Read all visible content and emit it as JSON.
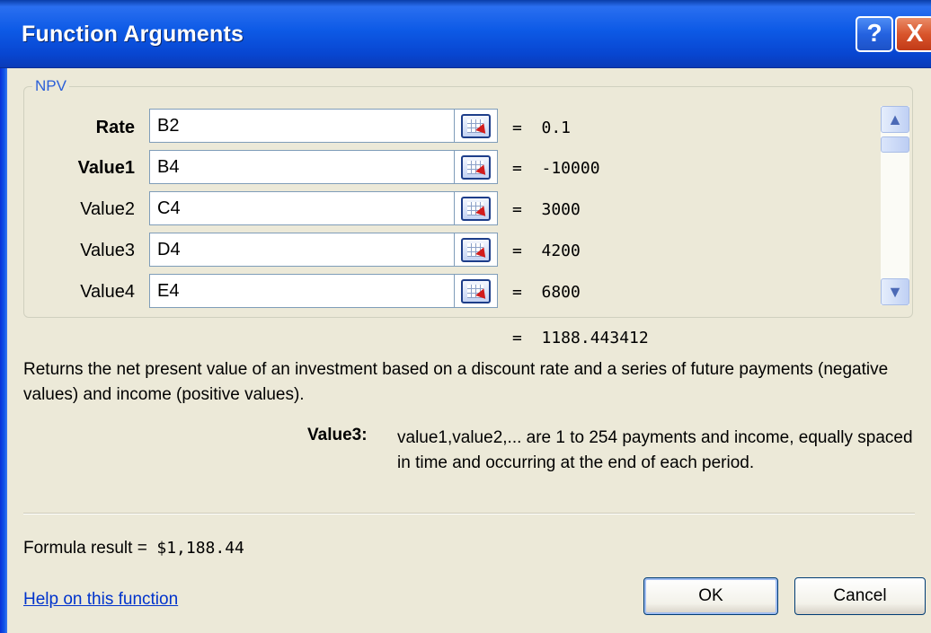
{
  "window": {
    "title": "Function Arguments",
    "help_symbol": "?",
    "close_symbol": "X"
  },
  "function": {
    "name": "NPV",
    "arguments": [
      {
        "label": "Rate",
        "bold": true,
        "input": "B2",
        "value": "=  0.1"
      },
      {
        "label": "Value1",
        "bold": true,
        "input": "B4",
        "value": "=  -10000"
      },
      {
        "label": "Value2",
        "bold": false,
        "input": "C4",
        "value": "=  3000"
      },
      {
        "label": "Value3",
        "bold": false,
        "input": "D4",
        "value": "=  4200"
      },
      {
        "label": "Value4",
        "bold": false,
        "input": "E4",
        "value": "=  6800"
      }
    ],
    "result": "=  1188.443412",
    "description": "Returns the net present value of an investment based on a discount rate and a series of future payments (negative values) and income (positive values).",
    "selected_argument": "Value3:",
    "argument_description": "value1,value2,... are 1 to 254 payments and income, equally spaced in time and occurring at the end of each period."
  },
  "footer": {
    "formula_result_label": "Formula result =",
    "formula_result_value": "$1,188.44",
    "help_link": "Help on this function",
    "ok_label": "OK",
    "cancel_label": "Cancel"
  },
  "colors": {
    "titlebar": "#0d5ae6",
    "dialog_bg": "#ece9d8",
    "group_title": "#2b5fd8",
    "link": "#0033cc"
  },
  "icons": {
    "help": "help-icon",
    "close": "close-icon",
    "ref": "range-select-icon",
    "scroll_up": "chevron-up-icon",
    "scroll_down": "chevron-down-icon"
  }
}
